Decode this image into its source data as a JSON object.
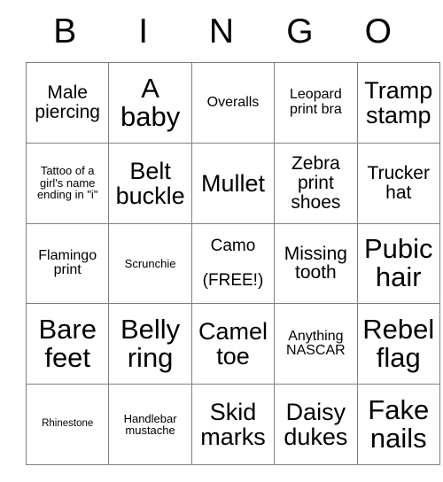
{
  "card": {
    "header_letters": [
      "B",
      "I",
      "N",
      "G",
      "O"
    ],
    "rows": [
      [
        {
          "text": "Male piercing",
          "size": "sz-md"
        },
        {
          "text": "A baby",
          "size": "sz-xl"
        },
        {
          "text": "Overalls",
          "size": "sz-sm"
        },
        {
          "text": "Leopard print bra",
          "size": "sz-sm"
        },
        {
          "text": "Tramp stamp",
          "size": "sz-lg"
        }
      ],
      [
        {
          "text": "Tattoo of a girl's name ending in \"i\"",
          "size": "sz-xs"
        },
        {
          "text": "Belt buckle",
          "size": "sz-lg"
        },
        {
          "text": "Mullet",
          "size": "sz-lg"
        },
        {
          "text": "Zebra print shoes",
          "size": "sz-md"
        },
        {
          "text": "Trucker hat",
          "size": "sz-md"
        }
      ],
      [
        {
          "text": "Flamingo print",
          "size": "sz-sm"
        },
        {
          "text": "Scrunchie",
          "size": "sz-xs"
        },
        {
          "text": "Camo",
          "free": true,
          "free_label": "(FREE!)",
          "size": "sz-md"
        },
        {
          "text": "Missing tooth",
          "size": "sz-md"
        },
        {
          "text": "Pubic hair",
          "size": "sz-xl"
        }
      ],
      [
        {
          "text": "Bare feet",
          "size": "sz-xl"
        },
        {
          "text": "Belly ring",
          "size": "sz-xl"
        },
        {
          "text": "Camel toe",
          "size": "sz-lg"
        },
        {
          "text": "Anything NASCAR",
          "size": "sz-sm"
        },
        {
          "text": "Rebel flag",
          "size": "sz-xl"
        }
      ],
      [
        {
          "text": "Rhinestone",
          "size": "sz-xxs"
        },
        {
          "text": "Handlebar mustache",
          "size": "sz-xs"
        },
        {
          "text": "Skid marks",
          "size": "sz-lg"
        },
        {
          "text": "Daisy dukes",
          "size": "sz-lg"
        },
        {
          "text": "Fake nails",
          "size": "sz-xl"
        }
      ]
    ]
  }
}
